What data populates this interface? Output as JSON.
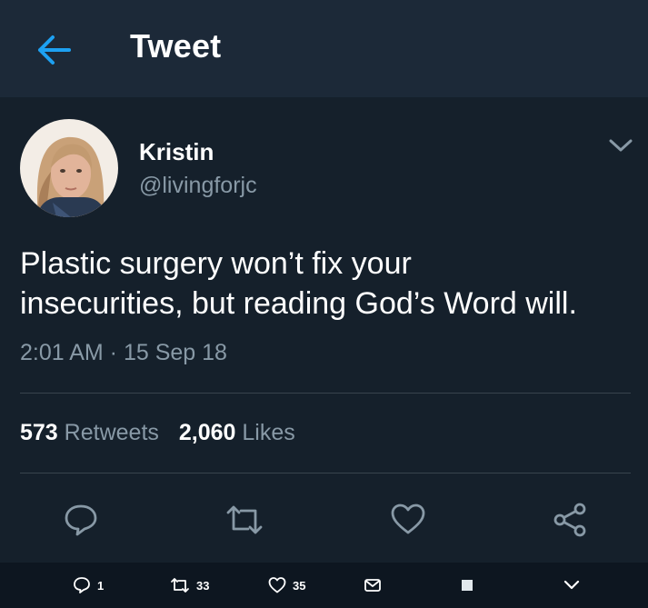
{
  "header": {
    "title": "Tweet",
    "back_icon": "arrow-left-icon"
  },
  "tweet": {
    "author_name": "Kristin",
    "author_handle": "@livingforjc",
    "text_line1": "Plastic surgery won’t fix your",
    "text_line2": "insecurities, but reading God’s Word will.",
    "timestamp": "2:01 AM · 15 Sep 18"
  },
  "stats": {
    "retweets_count": "573",
    "retweets_label": "Retweets",
    "likes_count": "2,060",
    "likes_label": "Likes"
  },
  "actions": [
    "reply-icon",
    "retweet-icon",
    "like-icon",
    "share-icon"
  ],
  "bottom_bar": {
    "reply_count": "1",
    "retweet_count": "33",
    "like_count": "35"
  },
  "colors": {
    "background": "#15202b",
    "header": "#1c2938",
    "accent": "#1da1f2",
    "secondary_text": "#8899a6",
    "divider": "#38444d"
  }
}
